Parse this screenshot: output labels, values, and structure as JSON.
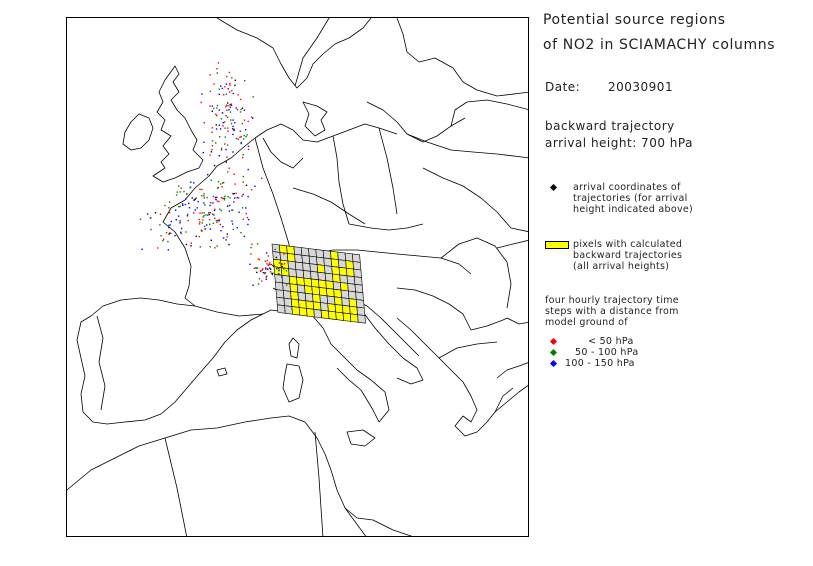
{
  "title": {
    "line1": "Potential source regions",
    "line2": "of NO2 in SCIAMACHY columns"
  },
  "date": {
    "label": "Date:",
    "value": "20030901"
  },
  "trajectory": {
    "line1": "backward trajectory",
    "line2": "arrival height:  700  hPa"
  },
  "legend": {
    "arrival": {
      "line1": "arrival coordinates of",
      "line2": "trajectories (for arrival",
      "line3": "height indicated above)",
      "color": "#000000"
    },
    "pixels": {
      "line1": "pixels with calculated",
      "line2": "backward trajectories",
      "line3": "(all arrival heights)",
      "color": "#ffff00"
    },
    "steps": {
      "line1": "four hourly trajectory time",
      "line2": "steps with a distance from",
      "line3": "model ground of",
      "items": [
        {
          "label": "<   50  hPa",
          "color": "#ff0000"
        },
        {
          "label": "50  -  100  hPa",
          "color": "#008000"
        },
        {
          "label": "100  -  150  hPa",
          "color": "#0000ff"
        }
      ]
    }
  }
}
